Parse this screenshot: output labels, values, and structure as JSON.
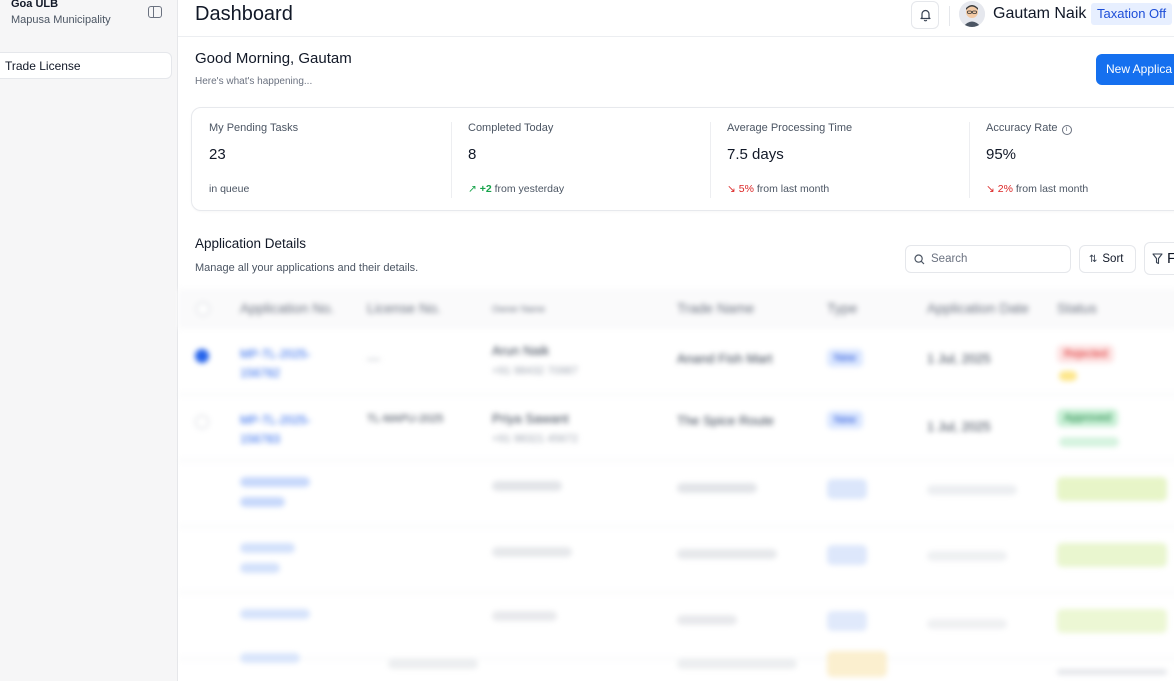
{
  "sidebar": {
    "org_title": "Goa ULB",
    "org_subtitle": "Mapusa Municipality",
    "items": [
      {
        "label": "Trade License",
        "active": true
      }
    ]
  },
  "header": {
    "title": "Dashboard",
    "user_name": "Gautam Naik",
    "user_role": "Taxation Off"
  },
  "greeting": {
    "title": "Good Morning, Gautam",
    "subtitle": "Here's what's happening...",
    "primary_button": "New Applica"
  },
  "stats": [
    {
      "label": "My Pending Tasks",
      "value": "23",
      "foot_text": "in queue"
    },
    {
      "label": "Completed Today",
      "value": "8",
      "change": "+2",
      "foot_text": "from yesterday",
      "trend": "up"
    },
    {
      "label": "Average Processing Time",
      "value": "7.5 days",
      "change": "5%",
      "foot_text": "from last month",
      "trend": "down"
    },
    {
      "label": "Accuracy Rate",
      "value": "95%",
      "change": "2%",
      "foot_text": "from last month",
      "trend": "down"
    }
  ],
  "applications": {
    "title": "Application Details",
    "subtitle": "Manage all your applications and their details.",
    "search_placeholder": "Search",
    "sort_label": "Sort",
    "filter_label": "F",
    "columns": [
      "Application No.",
      "License No.",
      "Owner Name",
      "Trade Name",
      "Type",
      "Application Date",
      "Status"
    ],
    "rows": [
      {
        "app_no": "MP-TL-2025-156782",
        "license": "—",
        "owner": "Arun Naik",
        "phone": "+91 98432 70987",
        "trade": "Anand Fish Mart",
        "type": "New",
        "date": "1 Jul, 2025",
        "status": "Rejected"
      },
      {
        "app_no": "MP-TL-2025-156783",
        "license": "TL-MAPU-2025",
        "owner": "Priya Sawant",
        "phone": "+91 98321 45672",
        "trade": "The Spice Route",
        "type": "New",
        "date": "1 Jul, 2025",
        "status": "Approved"
      }
    ]
  },
  "colors": {
    "accent": "#1570ef",
    "positive": "#16a34a",
    "negative": "#dc2626",
    "badge_bg": "#e7efff",
    "badge_text": "#1d4ed8"
  }
}
